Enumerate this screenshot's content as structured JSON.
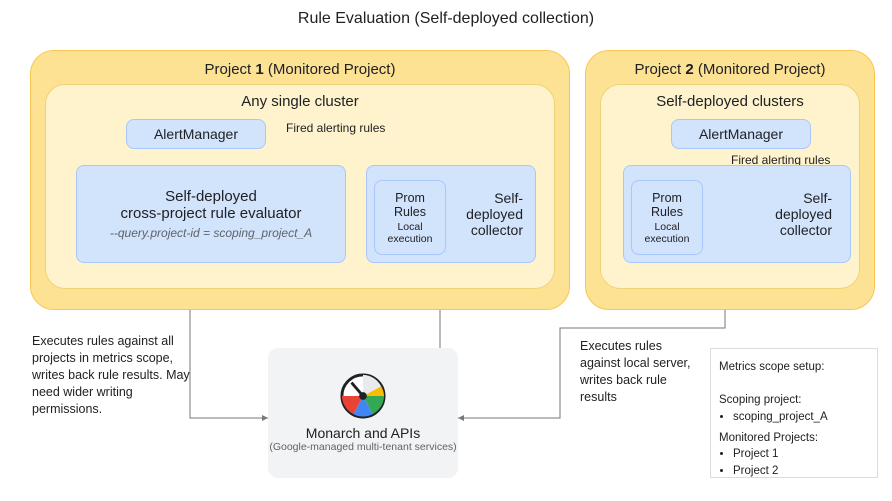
{
  "title": "Rule Evaluation (Self-deployed collection)",
  "project1": {
    "title": "Project 1 (Monitored Project)",
    "cluster_title": "Any single cluster",
    "alertmanager": "AlertManager",
    "fired_label": "Fired alerting rules",
    "evaluator": {
      "line1": "Self-deployed",
      "line2": "cross-project rule evaluator",
      "flag": "--query.project-id = scoping_project_A"
    },
    "prom": {
      "title": "Prom Rules",
      "sub": "Local execution"
    },
    "collector": {
      "line1": "Self-",
      "line2": "deployed",
      "line3": "collector"
    }
  },
  "project2": {
    "title": "Project 2 (Monitored Project)",
    "cluster_title": "Self-deployed clusters",
    "alertmanager": "AlertManager",
    "fired_label": "Fired alerting rules",
    "prom": {
      "title": "Prom Rules",
      "sub": "Local execution"
    },
    "collector": {
      "line1": "Self-",
      "line2": "deployed",
      "line3": "collector"
    }
  },
  "notes": {
    "left": "Executes rules against all projects in metrics scope, writes back rule results. May need wider writing permissions.",
    "right": "Executes rules against local server, writes back rule results"
  },
  "monarch": {
    "title": "Monarch and APIs",
    "sub": "(Google-managed multi-tenant services)"
  },
  "scope": {
    "header": "Metrics scope setup:",
    "scoping_label": "Scoping project:",
    "scoping_value": "scoping_project_A",
    "monitored_label": "Monitored Projects:",
    "monitored_1": "Project 1",
    "monitored_2": "Project 2"
  }
}
